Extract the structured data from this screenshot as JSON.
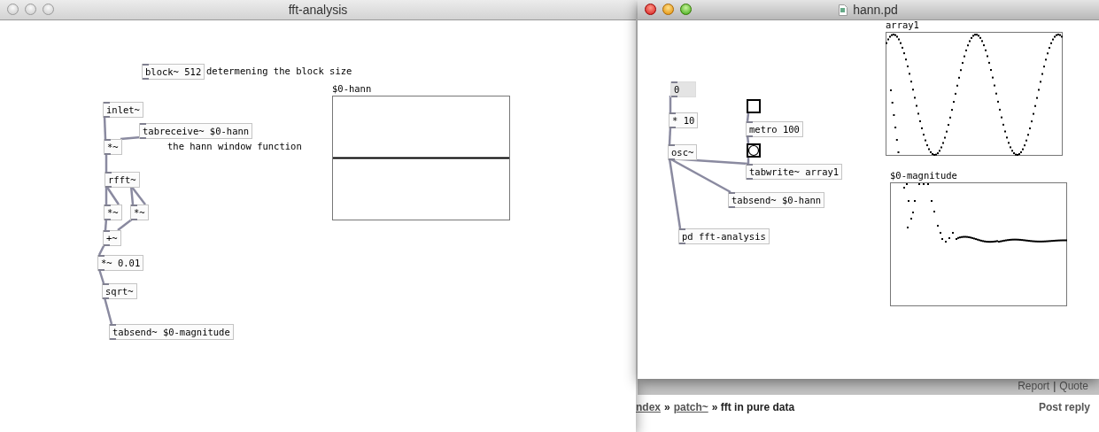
{
  "windows": [
    {
      "title": "fft-analysis",
      "focused": false,
      "objects": [
        {
          "kind": "object",
          "text": "block~ 512"
        },
        {
          "kind": "comment",
          "text": "determening the block size"
        },
        {
          "kind": "object",
          "text": "inlet~"
        },
        {
          "kind": "object",
          "text": "tabreceive~ $0-hann"
        },
        {
          "kind": "object",
          "text": "*~"
        },
        {
          "kind": "comment",
          "text": "the hann window function"
        },
        {
          "kind": "object",
          "text": "rfft~"
        },
        {
          "kind": "object",
          "text": "*~"
        },
        {
          "kind": "object",
          "text": "*~"
        },
        {
          "kind": "object",
          "text": "+~"
        },
        {
          "kind": "object",
          "text": "*~ 0.01"
        },
        {
          "kind": "object",
          "text": "sqrt~"
        },
        {
          "kind": "object",
          "text": "tabsend~ $0-magnitude"
        }
      ],
      "arrays": [
        {
          "name": "$0-hann",
          "kind": "flat"
        }
      ]
    },
    {
      "title": "hann.pd",
      "focused": true,
      "objects": [
        {
          "kind": "number",
          "text": "0"
        },
        {
          "kind": "object",
          "text": "* 10"
        },
        {
          "kind": "object",
          "text": "osc~"
        },
        {
          "kind": "toggle",
          "on": false
        },
        {
          "kind": "object",
          "text": "metro 100"
        },
        {
          "kind": "bang"
        },
        {
          "kind": "object",
          "text": "tabwrite~ array1"
        },
        {
          "kind": "object",
          "text": "tabsend~ $0-hann"
        },
        {
          "kind": "object",
          "text": "pd fft-analysis"
        }
      ],
      "arrays": [
        {
          "name": "array1",
          "kind": "sine"
        },
        {
          "name": "$0-magnitude",
          "kind": "spectrum"
        }
      ]
    }
  ],
  "page": {
    "actions": [
      {
        "kind": "link",
        "text": "Report"
      },
      {
        "kind": "sep",
        "text": "|"
      },
      {
        "kind": "link",
        "text": "Quote"
      }
    ],
    "breadcrumb": [
      {
        "kind": "link",
        "text": "ndex"
      },
      {
        "kind": "sep",
        "text": "»"
      },
      {
        "kind": "link",
        "text": "patch~"
      },
      {
        "kind": "current",
        "text": "» fft in pure data"
      }
    ],
    "post_reply": "Post reply"
  }
}
